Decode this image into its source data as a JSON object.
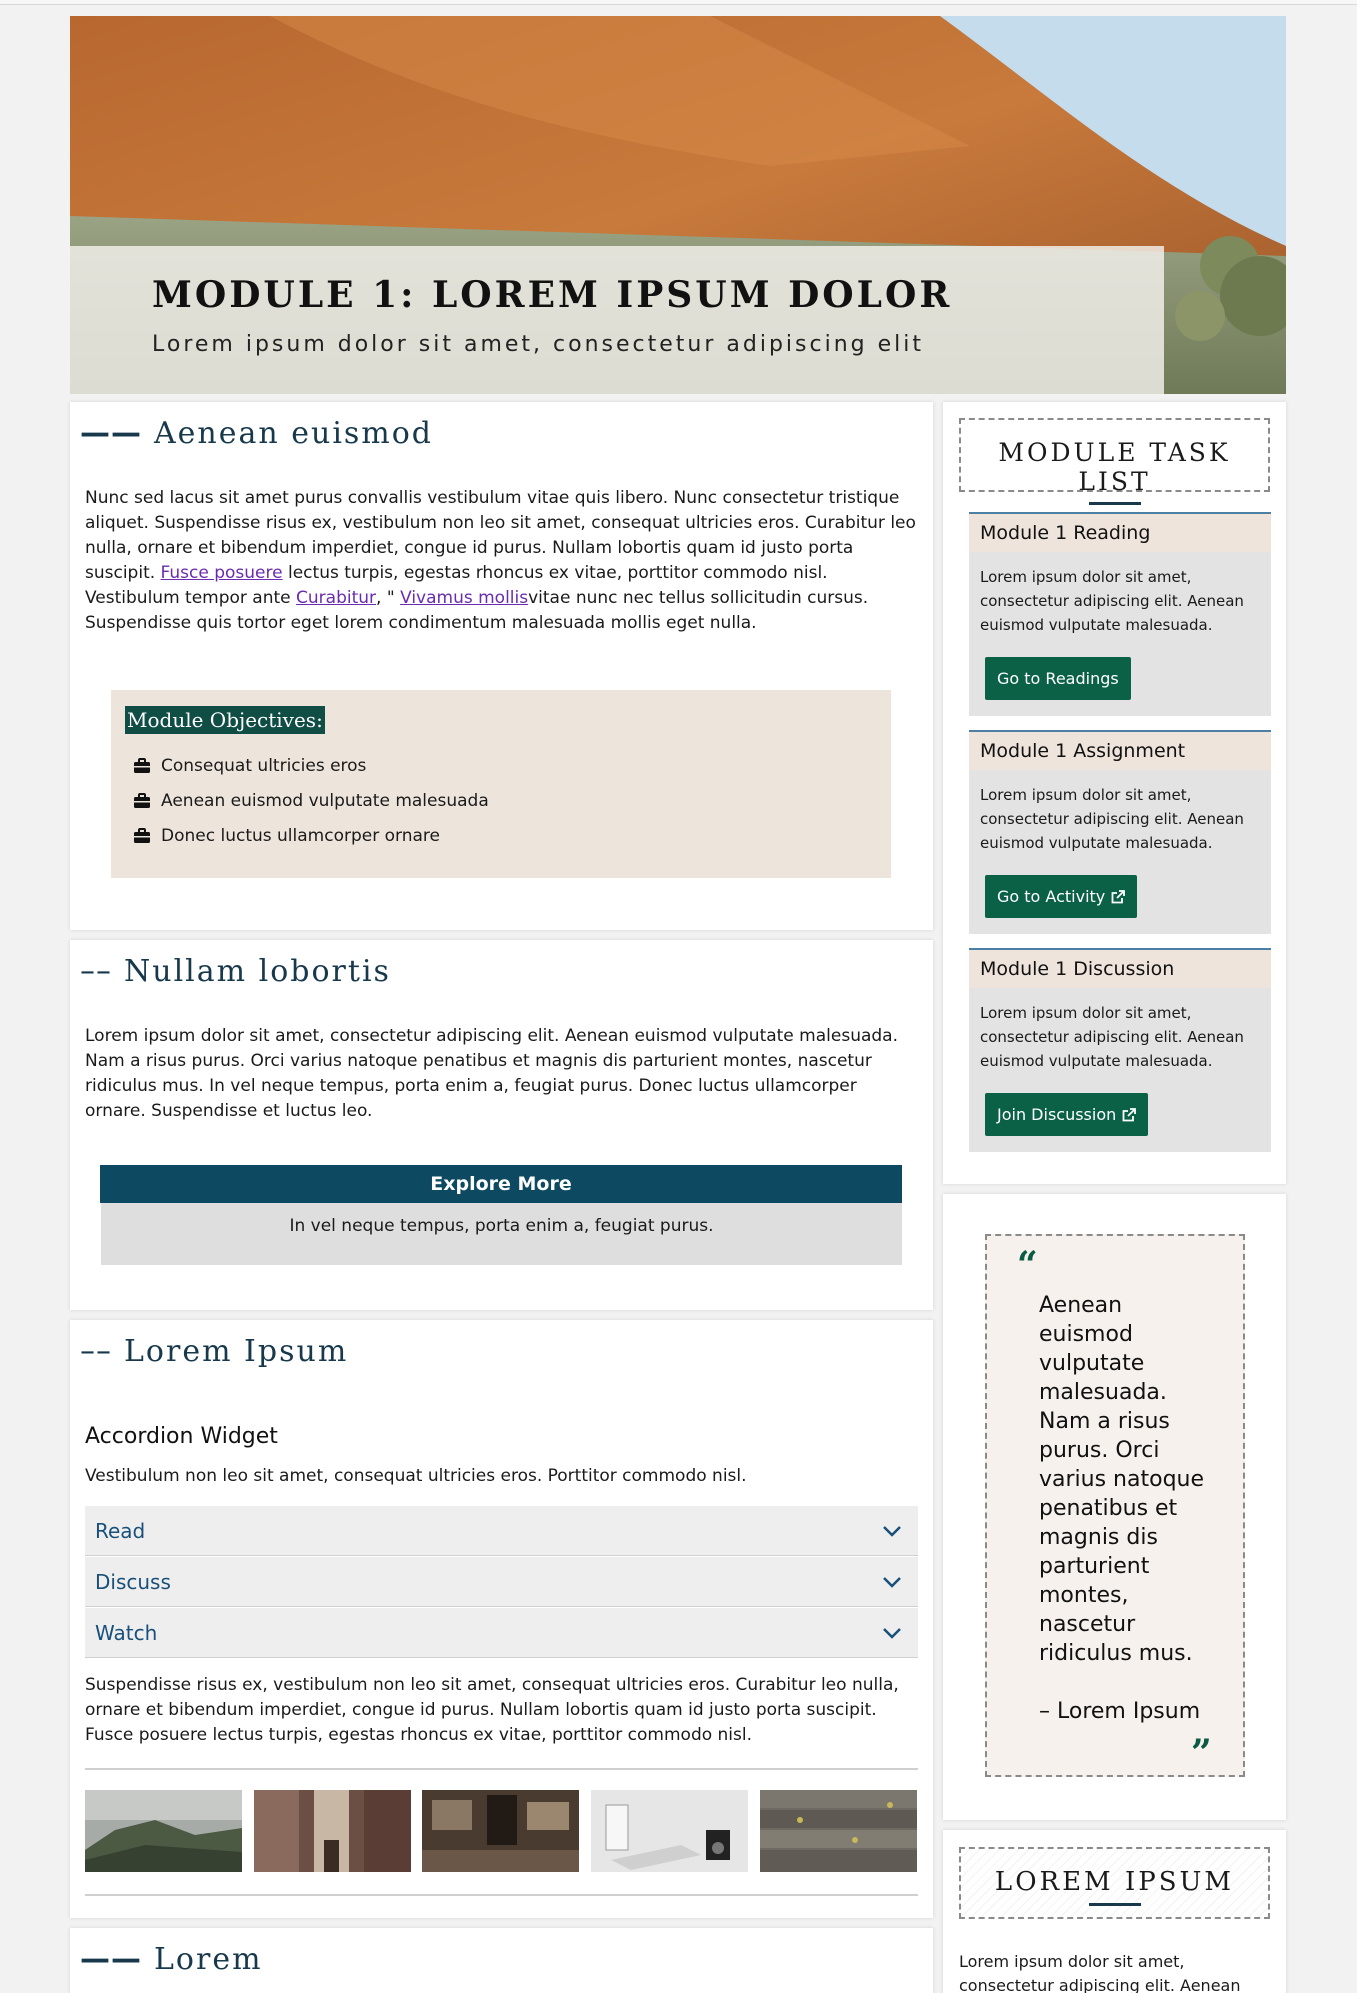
{
  "hero": {
    "title": "MODULE 1: LOREM IPSUM DOLOR",
    "subtitle": "Lorem ipsum dolor sit amet, consectetur adipiscing elit"
  },
  "section1": {
    "dashes": "——",
    "heading": "Aenean euismod",
    "text_a": "Nunc sed lacus sit amet purus convallis vestibulum vitae quis libero. Nunc consectetur tristique aliquet. Suspendisse risus ex, vestibulum non leo sit amet, consequat ultricies eros. Curabitur leo nulla, ornare et bibendum imperdiet, congue id purus. Nullam lobortis quam id justo porta suscipit. ",
    "link1": "Fusce posuere",
    "text_b": " lectus turpis, egestas rhoncus ex vitae, porttitor commodo nisl. Vestibulum tempor ante ",
    "link2": "Curabitur",
    "text_c": ", \" ",
    "link3": "Vivamus mollis",
    "text_d": "vitae nunc nec tellus sollicitudin cursus. Suspendisse quis tortor eget lorem condimentum malesuada mollis eget nulla.",
    "objectives_title": "Module Objectives:",
    "objectives": [
      "Consequat ultricies eros",
      "Aenean euismod vulputate malesuada",
      "Donec luctus ullamcorper ornare"
    ]
  },
  "section2": {
    "dashes": "––",
    "heading": "Nullam lobortis",
    "text": "Lorem ipsum dolor sit amet, consectetur adipiscing elit. Aenean euismod vulputate malesuada. Nam a risus purus. Orci varius natoque penatibus et magnis dis parturient montes, nascetur ridiculus mus. In vel neque tempus, porta enim a, feugiat purus. Donec luctus ullamcorper ornare. Suspendisse et luctus leo.",
    "explore_title": "Explore More",
    "explore_text": "In vel neque tempus, porta enim a, feugiat purus."
  },
  "section3": {
    "dashes": "––",
    "heading": "Lorem Ipsum",
    "accordion_title": "Accordion Widget",
    "accordion_intro": "Vestibulum non leo sit amet, consequat ultricies eros. Porttitor commodo nisl.",
    "accordion_items": [
      "Read",
      "Discuss",
      "Watch"
    ],
    "after_text": "Suspendisse risus ex, vestibulum non leo sit amet, consequat ultricies eros. Curabitur leo nulla, ornare et bibendum imperdiet, congue id purus. Nullam lobortis quam id justo porta suscipit. Fusce posuere lectus turpis, egestas rhoncus ex vitae, porttitor commodo nisl."
  },
  "section4": {
    "dashes": "——",
    "heading": "Lorem"
  },
  "sidebar": {
    "task_list_title": "MODULE TASK LIST",
    "tasks": [
      {
        "title": "Module 1 Reading",
        "text": "Lorem ipsum dolor sit amet, consectetur adipiscing elit. Aenean euismod vulputate malesuada.",
        "button": "Go to Readings"
      },
      {
        "title": "Module 1 Assignment",
        "text": "Lorem ipsum dolor sit amet, consectetur adipiscing elit. Aenean euismod vulputate malesuada.",
        "button": "Go to Activity"
      },
      {
        "title": "Module 1 Discussion",
        "text": "Lorem ipsum dolor sit amet, consectetur adipiscing elit. Aenean euismod vulputate malesuada.",
        "button": "Join Discussion"
      }
    ],
    "quote_open": "“",
    "quote_text": "Aenean euismod vulputate malesuada. Nam a risus purus. Orci varius natoque penatibus et magnis dis parturient montes, nascetur ridiculus mus.",
    "quote_author": "– Lorem Ipsum",
    "quote_close": "”",
    "box2_title": "LOREM IPSUM",
    "box2_text": "Lorem ipsum dolor sit amet, consectetur adipiscing elit. Aenean"
  },
  "colors": {
    "heading": "#18394c",
    "button": "#0b6146",
    "explore": "#0d4a61",
    "objectives_bg": "#ede5dc",
    "link": "#6a2bb0"
  },
  "icons": {
    "objective_bullet": "briefcase-icon",
    "accordion_toggle": "chevron-down-icon",
    "external_link": "external-link-icon"
  }
}
